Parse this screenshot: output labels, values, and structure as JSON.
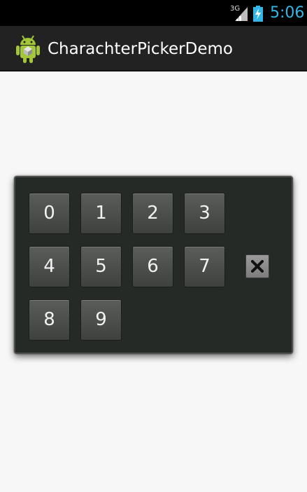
{
  "status_bar": {
    "network": "3G",
    "time": "5:06",
    "icons": [
      "signal-icon",
      "battery-charging-icon"
    ]
  },
  "action_bar": {
    "title": "CharachterPickerDemo",
    "icon": "android-icon"
  },
  "picker": {
    "keys": [
      "0",
      "1",
      "2",
      "3",
      "4",
      "5",
      "6",
      "7",
      "8",
      "9"
    ],
    "delete_icon": "close-icon"
  },
  "colors": {
    "status_bar_bg": "#000000",
    "clock": "#33b5e5",
    "action_bar_bg": "#222222",
    "panel_bg": "#252a26",
    "key_bg": "#4d4f4d",
    "background": "#f7f7f7"
  }
}
